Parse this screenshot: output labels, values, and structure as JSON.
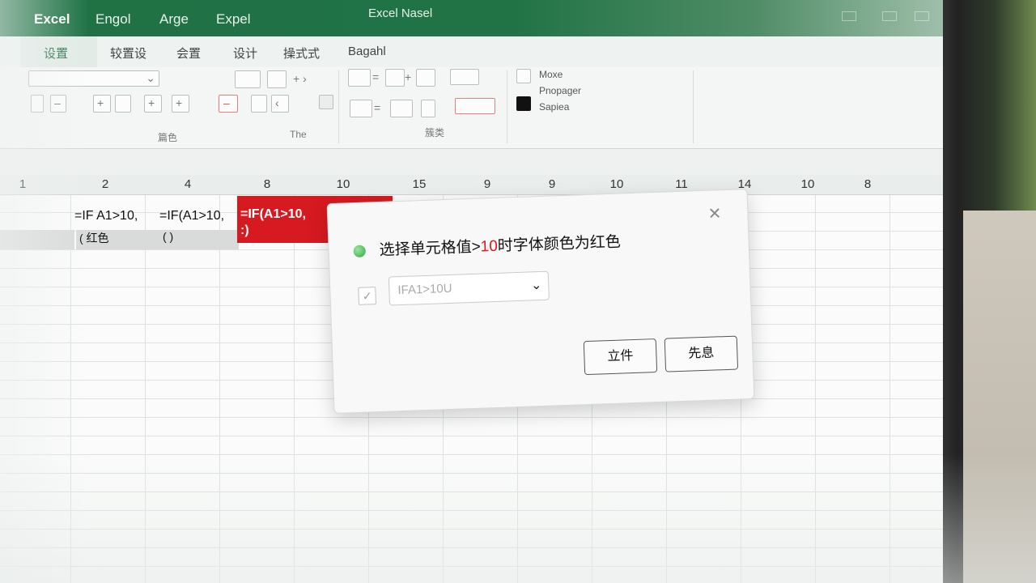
{
  "window": {
    "title": "Excel Nasel",
    "app_tabs": [
      "Excel",
      "Engol",
      "Arge",
      "Expel"
    ]
  },
  "ribbon": {
    "tabs": [
      "设置",
      "较置设",
      "会置",
      "设计",
      "操式式",
      "Bagahl"
    ],
    "active_tab": 0,
    "group_labels": [
      "篇色",
      "The",
      "簇类"
    ],
    "style_items": [
      "Moxe",
      "Pnopager",
      "Sapiea"
    ],
    "top_left_select_value": ""
  },
  "sheet": {
    "column_headers": [
      "1",
      "2",
      "4",
      "8",
      "10",
      "15",
      "9",
      "9",
      "10",
      "11",
      "14",
      "10",
      "8"
    ],
    "cells": [
      {
        "text": "=IF A1>10,",
        "style": "plain"
      },
      {
        "text": "=IF(A1>10,",
        "style": "plain"
      },
      {
        "text": "=IF(A1>10,",
        "style": "red"
      },
      {
        "text": "(  红色",
        "style": "grey"
      },
      {
        "text": "(  )",
        "style": "grey"
      },
      {
        "text": ":)",
        "style": "red"
      }
    ]
  },
  "dialog": {
    "message_prefix": "选择单元格值>",
    "message_highlight": "10",
    "message_suffix": "时字体颜色为红色",
    "dropdown_value": "IFA1>10U",
    "checkbox_checked": true,
    "primary_button": "立件",
    "secondary_button": "先息",
    "close_glyph": "✕"
  },
  "colors": {
    "excel_green": "#217346",
    "highlight_red": "#d71920",
    "status_dot": "#2fa64a"
  },
  "icons": [
    "close-icon",
    "status-dot-icon",
    "checkbox-icon",
    "chevron-down-icon"
  ]
}
